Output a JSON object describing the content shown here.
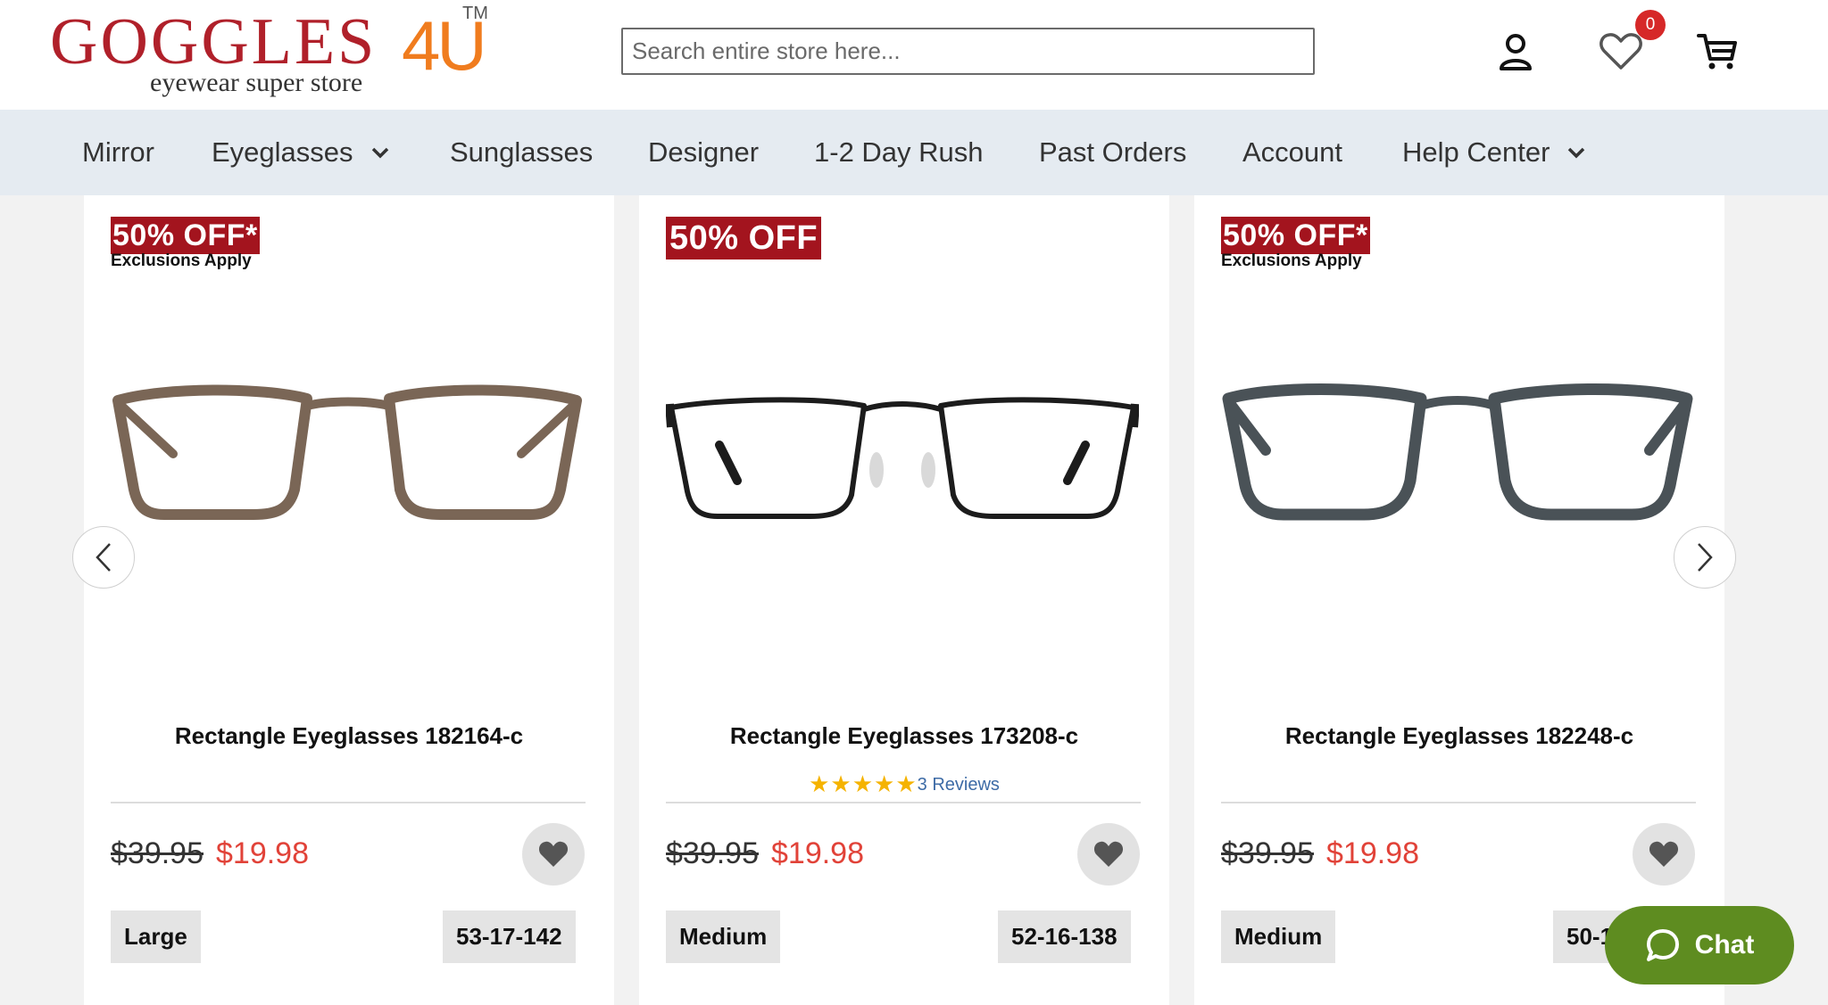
{
  "logo": {
    "word": "GOGGLES",
    "num": "4U",
    "tm": "TM",
    "tagline": "eyewear super store"
  },
  "search": {
    "placeholder": "Search entire store here..."
  },
  "header_icons": {
    "account": "user-icon",
    "wishlist": "heart-outline-icon",
    "wishlist_count": "0",
    "cart": "cart-icon"
  },
  "nav": {
    "items": [
      {
        "label": "Mirror",
        "has_dropdown": false
      },
      {
        "label": "Eyeglasses",
        "has_dropdown": true
      },
      {
        "label": "Sunglasses",
        "has_dropdown": false
      },
      {
        "label": "Designer",
        "has_dropdown": false
      },
      {
        "label": "1-2 Day Rush",
        "has_dropdown": false
      },
      {
        "label": "Past Orders",
        "has_dropdown": false
      },
      {
        "label": "Account",
        "has_dropdown": false
      },
      {
        "label": "Help Center",
        "has_dropdown": true
      }
    ]
  },
  "products": [
    {
      "promo": "50% OFF*",
      "promo_note": "Exclusions Apply",
      "name": "Rectangle Eyeglasses 182164-c",
      "rating": null,
      "reviews": "",
      "old_price": "$39.95",
      "price": "$19.98",
      "size": "Large",
      "measurements": "53-17-142",
      "frame_color": "#7a6656"
    },
    {
      "promo": "50% OFF",
      "promo_note": "",
      "name": "Rectangle Eyeglasses 173208-c",
      "rating": 5,
      "reviews": "3 Reviews",
      "old_price": "$39.95",
      "price": "$19.98",
      "size": "Medium",
      "measurements": "52-16-138",
      "frame_color": "#1c1c1c"
    },
    {
      "promo": "50% OFF*",
      "promo_note": "Exclusions Apply",
      "name": "Rectangle Eyeglasses 182248-c",
      "rating": null,
      "reviews": "",
      "old_price": "$39.95",
      "price": "$19.98",
      "size": "Medium",
      "measurements": "50-1",
      "frame_color": "#4a5257"
    }
  ],
  "carousel": {
    "prev": "chevron-left-icon",
    "next": "chevron-right-icon"
  },
  "chat": {
    "label": "Chat"
  },
  "colors": {
    "brand_red": "#b0202a",
    "brand_orange": "#f07c1e",
    "sale_red": "#e14238",
    "promo_bg": "#a3141e",
    "chat_green": "#5e8c20",
    "star": "#f5b301"
  }
}
